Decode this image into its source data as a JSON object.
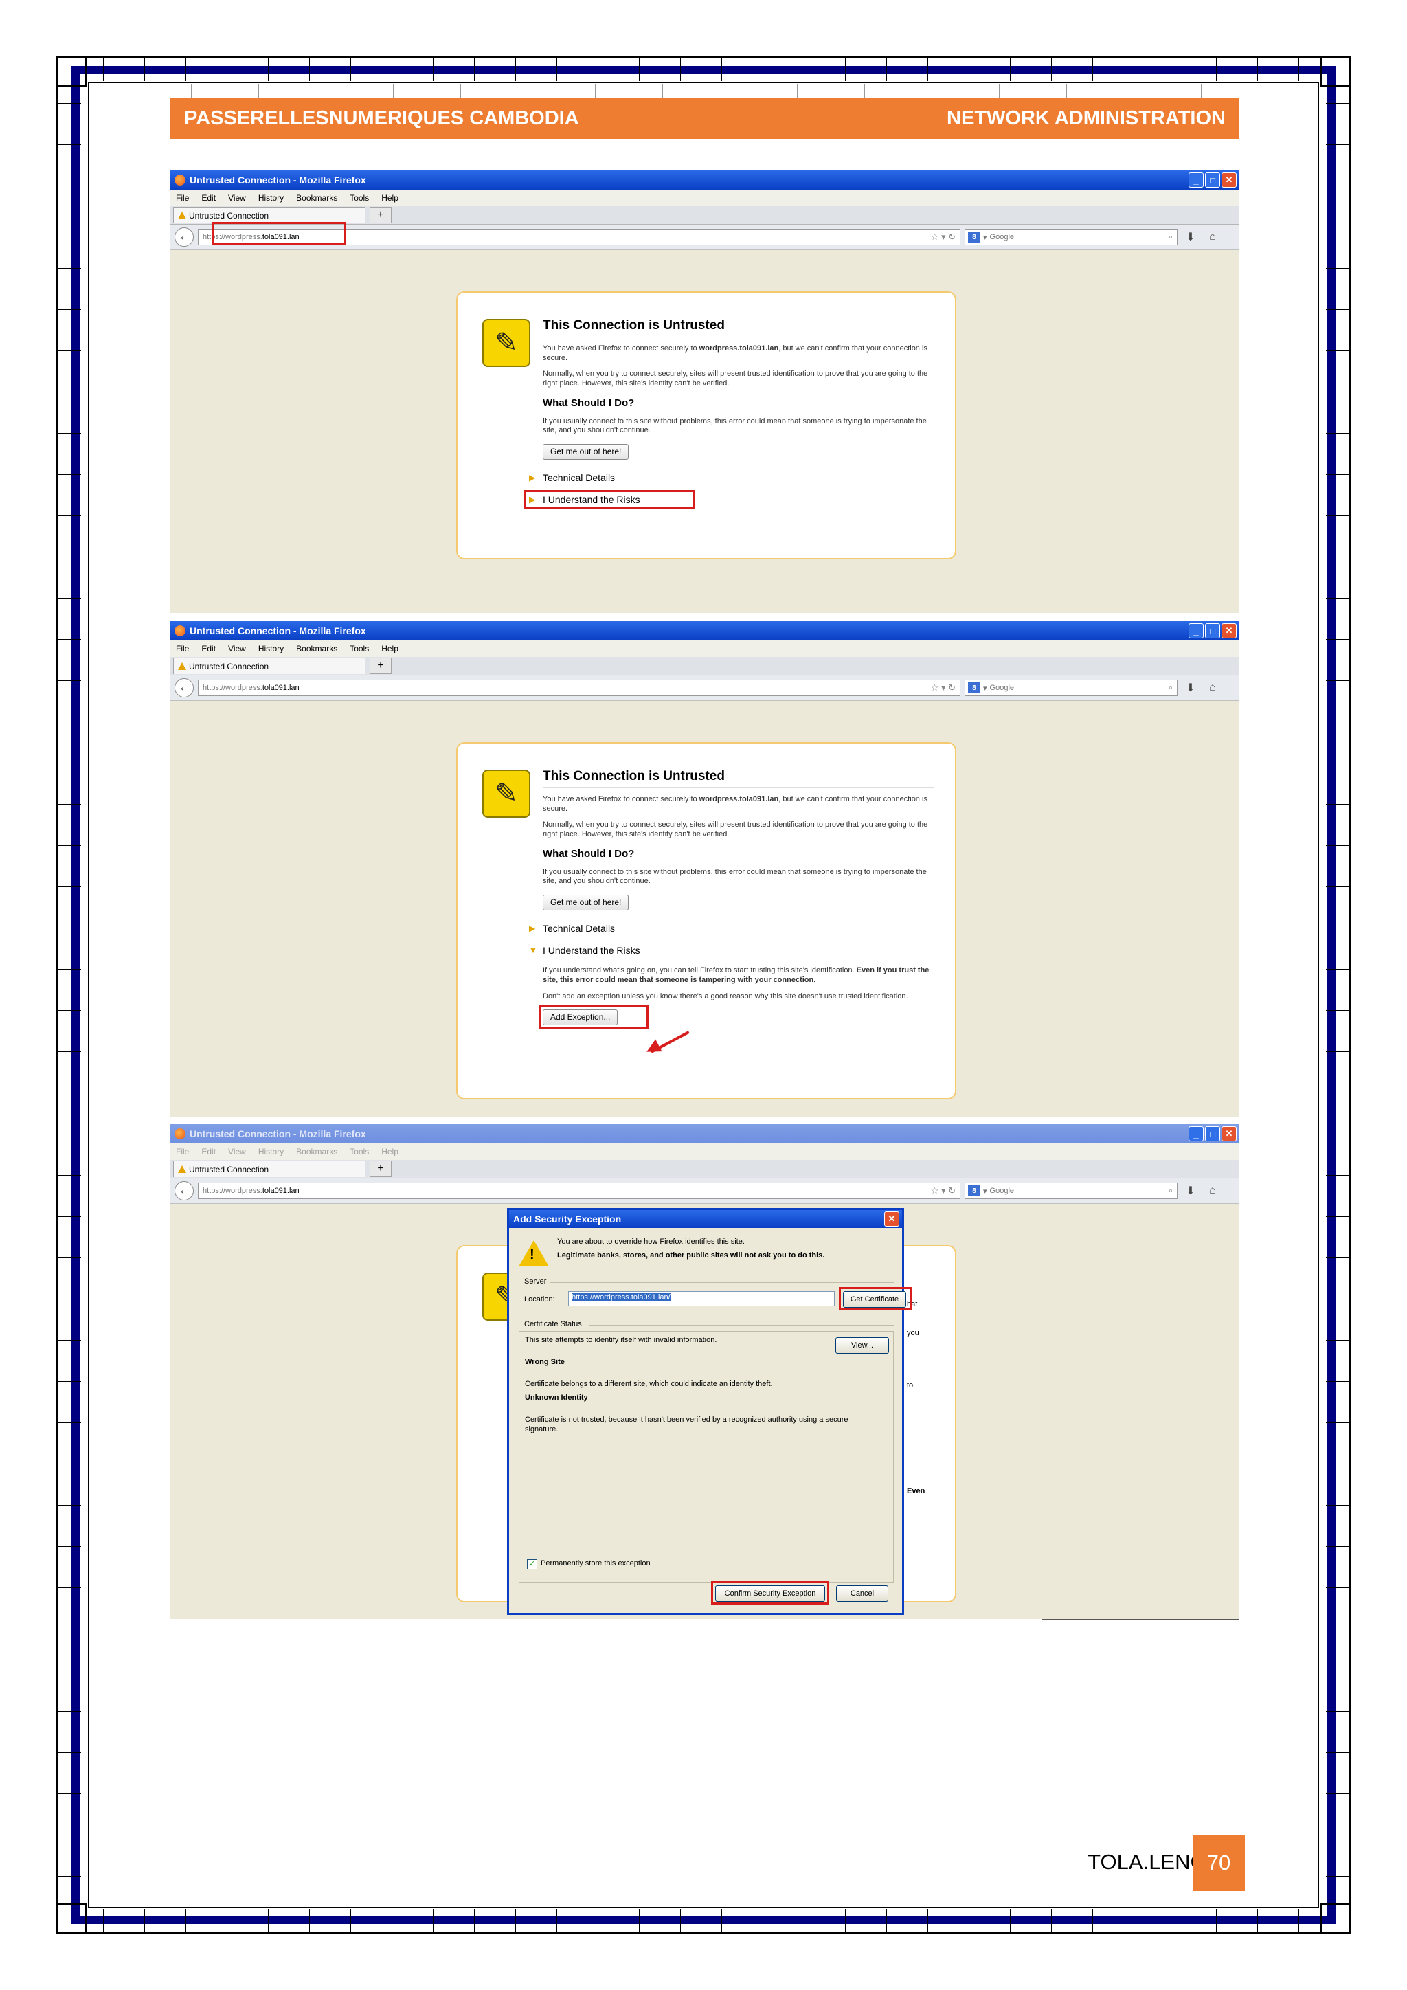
{
  "header": {
    "left": "PASSERELLESNUMERIQUES CAMBODIA",
    "right": "NETWORK ADMINISTRATION"
  },
  "browser": {
    "window_title": "Untrusted Connection - Mozilla Firefox",
    "menu": [
      "File",
      "Edit",
      "View",
      "History",
      "Bookmarks",
      "Tools",
      "Help"
    ],
    "tab_label": "Untrusted Connection",
    "new_tab": "+",
    "url_prefix": "https://wordpress.",
    "url_host": "tola091.lan",
    "search_placeholder": "Google",
    "search_engine_letter": "8",
    "icons": {
      "back": "arrow-left-icon",
      "bookmark": "star-icon",
      "reload": "reload-icon",
      "search": "magnifier-icon",
      "download": "download-icon",
      "home": "home-icon"
    }
  },
  "page": {
    "heading": "This Connection is Untrusted",
    "p1_a": "You have asked Firefox to connect securely to ",
    "p1_bold": "wordpress.tola091.lan",
    "p1_b": ", but we can't confirm that your connection is secure.",
    "p2": "Normally, when you try to connect securely, sites will present trusted identification to prove that you are going to the right place. However, this site's identity can't be verified.",
    "what_heading": "What Should I Do?",
    "p3": "If you usually connect to this site without problems, this error could mean that someone is trying to impersonate the site, and you shouldn't continue.",
    "get_out_button": "Get me out of here!",
    "technical_details": "Technical Details",
    "understand_risks": "I Understand the Risks",
    "risk_p1_a": "If you understand what's going on, you can tell Firefox to start trusting this site's identification. ",
    "risk_p1_bold": "Even if you trust the site, this error could mean that someone is tampering with your connection.",
    "risk_p2": "Don't add an exception unless you know there's a good reason why this site doesn't use trusted identification.",
    "add_exception_button": "Add Exception..."
  },
  "dialog": {
    "title": "Add Security Exception",
    "intro": "You are about to override how Firefox identifies this site.",
    "intro_bold": "Legitimate banks, stores, and other public sites will not ask you to do this.",
    "server_label": "Server",
    "location_label": "Location:",
    "location_value": "https://wordpress.tola091.lan/",
    "get_certificate": "Get Certificate",
    "cert_status_label": "Certificate Status",
    "cert_status_text": "This site attempts to identify itself with invalid information.",
    "view_button": "View...",
    "wrong_site": "Wrong Site",
    "wrong_site_text": "Certificate belongs to a different site, which could indicate an identity theft.",
    "unknown_identity": "Unknown Identity",
    "unknown_identity_text": "Certificate is not trusted, because it hasn't been verified by a recognized authority using a secure signature.",
    "permanent_checkbox": "Permanently store this exception",
    "confirm_button": "Confirm Security Exception",
    "cancel_button": "Cancel",
    "behind_fragments": [
      "hat",
      "you",
      "to",
      "Even"
    ]
  },
  "footer": {
    "name": "TOLA.LENG-PC",
    "page_number": "70"
  },
  "colors": {
    "accent_orange": "#ef7d31",
    "frame_navy": "#000080",
    "highlight_red": "#d81d1d"
  }
}
